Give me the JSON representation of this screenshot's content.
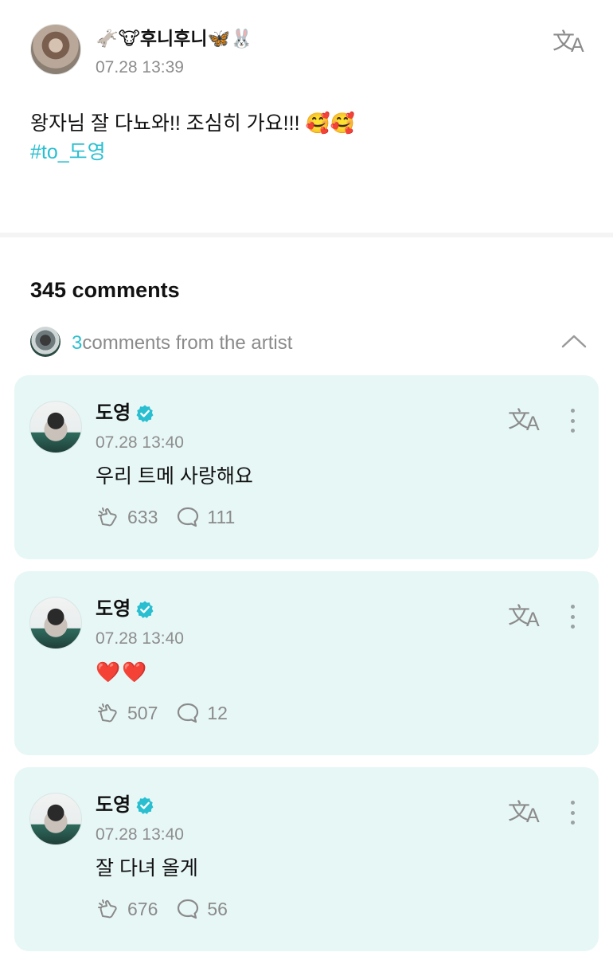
{
  "post": {
    "author_name": "🫏🐮후니후니🦋🐰",
    "time": "07.28 13:39",
    "body": "왕자님 잘 다뇨와!! 조심히 가요!!! 🥰🥰",
    "hashtag": "#to_도영",
    "translate_icon": "translate-icon"
  },
  "comments_section": {
    "header": "345 comments",
    "artist_count": "3",
    "artist_label": "comments from the artist"
  },
  "artist_comments": [
    {
      "name": "도영",
      "time": "07.28 13:40",
      "text": "우리 트메 사랑해요",
      "likes": "633",
      "replies": "111"
    },
    {
      "name": "도영",
      "time": "07.28 13:40",
      "text": "❤️❤️",
      "likes": "507",
      "replies": "12"
    },
    {
      "name": "도영",
      "time": "07.28 13:40",
      "text": "잘 다녀 올게",
      "likes": "676",
      "replies": "56"
    }
  ],
  "colors": {
    "accent": "#29bfd0",
    "card_bg": "#e7f7f6",
    "muted_text": "#8d8d8d"
  }
}
